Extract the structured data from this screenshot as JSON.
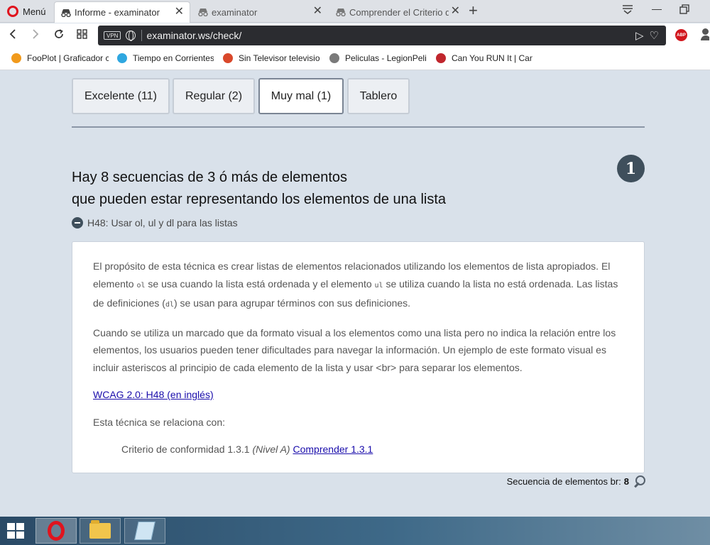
{
  "browser": {
    "menu_label": "Menú",
    "tabs": [
      {
        "label": "Informe - examinator",
        "active": true
      },
      {
        "label": "examinator",
        "active": false
      },
      {
        "label": "Comprender el Criterio de",
        "active": false
      }
    ],
    "url": "examinator.ws/check/",
    "vpn_label": "VPN",
    "abp_label": "ABP",
    "bookmarks": [
      {
        "label": "FooPlot | Graficador c",
        "color": "#f19a1c"
      },
      {
        "label": "Tiempo en Corrientes",
        "color": "#2fa7e0"
      },
      {
        "label": "Sin Televisor televisio",
        "color": "#d9482b"
      },
      {
        "label": "Peliculas - LegionPeli",
        "color": "#7a7a7a"
      },
      {
        "label": "Can You RUN It | Can",
        "color": "#c0262d"
      }
    ]
  },
  "report_tabs": [
    {
      "label": "Excelente (11)",
      "selected": false
    },
    {
      "label": "Regular (2)",
      "selected": false
    },
    {
      "label": "Muy mal (1)",
      "selected": true
    },
    {
      "label": "Tablero",
      "selected": false
    }
  ],
  "issue": {
    "title_line1": "Hay 8 secuencias de 3 ó más de elementos",
    "title_line2": "que pueden estar representando los elementos de una lista",
    "number": "1",
    "technique_toggle": "H48: Usar ol, ul y dl para las listas",
    "panel": {
      "p1_a": "El propósito de esta técnica es crear listas de elementos relacionados utilizando los elementos de lista apropiados. El elemento ",
      "code_ol": "ol",
      "p1_b": " se usa cuando la lista está ordenada y el elemento ",
      "code_ul": "ul",
      "p1_c": " se utiliza cuando la lista no está ordenada. Las listas de definiciones (",
      "code_dl": "dl",
      "p1_d": ") se usan para agrupar términos con sus definiciones.",
      "p2": "Cuando se utiliza un marcado que da formato visual a los elementos como una lista pero no indica la relación entre los elementos, los usuarios pueden tener dificultades para navegar la información. Un ejemplo de este formato visual es incluir asteriscos al principio de cada elemento de la lista y usar <br> para separar los elementos.",
      "wcag_link": "WCAG 2.0: H48 (en inglés)",
      "related_label": "Esta técnica se relaciona con:",
      "criterion_text": "Criterio de conformidad 1.3.1 ",
      "criterion_level": "(Nivel A)",
      "criterion_link": "Comprender 1.3.1"
    },
    "footer_label": "Secuencia de elementos br:",
    "footer_count": "8"
  }
}
